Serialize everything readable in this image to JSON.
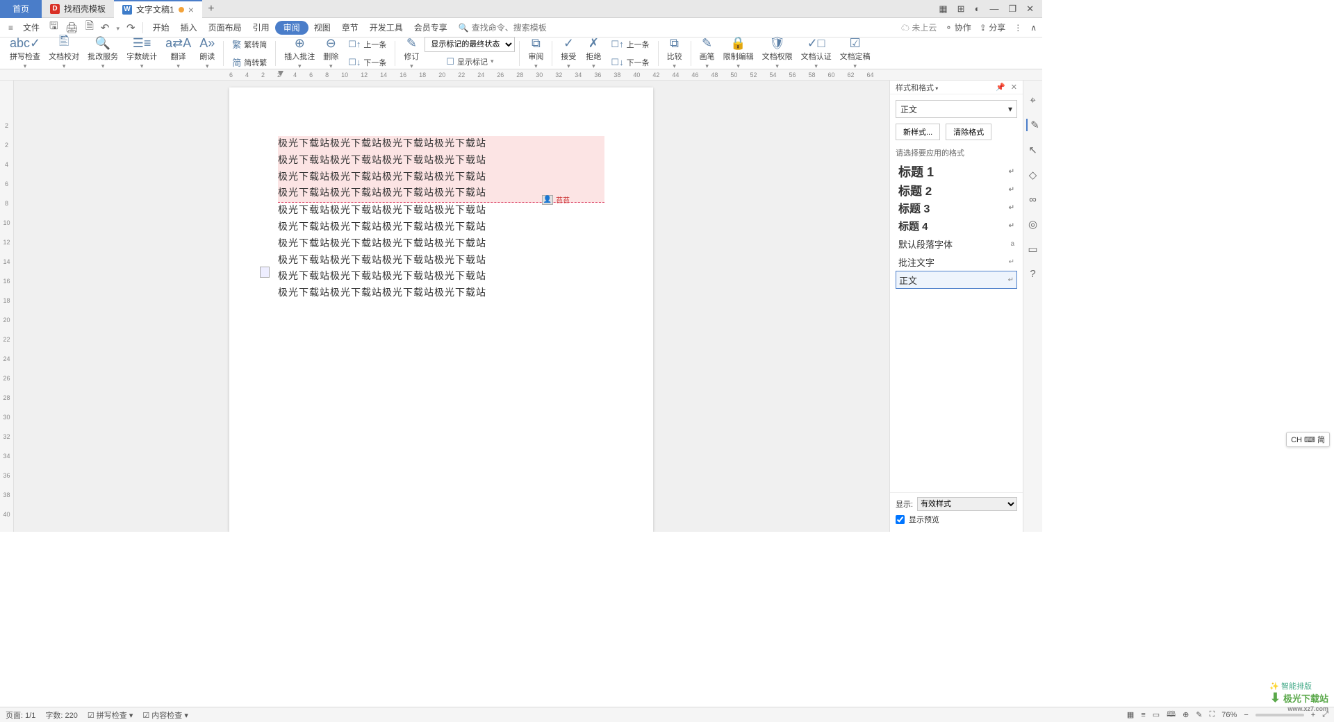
{
  "tabs": {
    "home": "首页",
    "template": "找稻壳模板",
    "doc": "文字文稿1"
  },
  "window_controls": {
    "grid": "▦",
    "apps": "⊞",
    "avatar": "◐",
    "min": "—",
    "max": "❐",
    "close": "✕"
  },
  "menubar": {
    "file": "文件",
    "items": [
      "开始",
      "插入",
      "页面布局",
      "引用",
      "审阅",
      "视图",
      "章节",
      "开发工具",
      "会员专享"
    ],
    "active": 4,
    "search_placeholder": "查找命令、搜索模板",
    "right": {
      "cloud": "未上云",
      "collab": "协作",
      "share": "分享"
    }
  },
  "ribbon": {
    "g1": [
      {
        "icon": "abc✓",
        "lbl": "拼写检查"
      },
      {
        "icon": "🖺",
        "lbl": "文档校对"
      },
      {
        "icon": "🔍",
        "lbl": "批改服务"
      },
      {
        "icon": "☰≡",
        "lbl": "字数统计"
      },
      {
        "icon": "a⇄A",
        "lbl": "翻译"
      },
      {
        "icon": "A»",
        "lbl": "朗读"
      }
    ],
    "g2a": {
      "icon": "繁",
      "lbl": "繁转简"
    },
    "g2b": {
      "icon": "简",
      "lbl": "简转繁"
    },
    "g3": [
      {
        "icon": "⊕",
        "lbl": "插入批注"
      },
      {
        "icon": "⊖",
        "lbl": "删除"
      }
    ],
    "g3b": [
      {
        "icon": "☐↑",
        "lbl": "上一条"
      },
      {
        "icon": "☐↓",
        "lbl": "下一条"
      }
    ],
    "g4": {
      "icon": "✎",
      "lbl": "修订"
    },
    "select": "显示标记的最终状态",
    "show_mark": {
      "icon": "☐",
      "lbl": "显示标记"
    },
    "g5": {
      "icon": "⧉",
      "lbl": "审阅"
    },
    "g6a": {
      "icon": "✓",
      "lbl": "接受"
    },
    "g6b": {
      "icon": "✗",
      "lbl": "拒绝"
    },
    "g6c": [
      {
        "icon": "☐↑",
        "lbl": "上一条"
      },
      {
        "icon": "☐↓",
        "lbl": "下一条"
      }
    ],
    "g7": {
      "icon": "⧉",
      "lbl": "比较"
    },
    "g8": [
      {
        "icon": "✎",
        "lbl": "画笔"
      },
      {
        "icon": "🔒",
        "lbl": "限制编辑"
      },
      {
        "icon": "🛡",
        "lbl": "文档权限"
      },
      {
        "icon": "✓□",
        "lbl": "文档认证"
      },
      {
        "icon": "☑",
        "lbl": "文档定稿"
      }
    ]
  },
  "ruler": [
    "6",
    "4",
    "2",
    "2",
    "4",
    "6",
    "8",
    "10",
    "12",
    "14",
    "16",
    "18",
    "20",
    "22",
    "24",
    "26",
    "28",
    "30",
    "32",
    "34",
    "36",
    "38",
    "40",
    "42",
    "44",
    "46",
    "48",
    "50",
    "52",
    "54",
    "56",
    "58",
    "60",
    "62",
    "64"
  ],
  "ruler_v": [
    "2",
    "2",
    "4",
    "6",
    "8",
    "10",
    "12",
    "14",
    "16",
    "18",
    "20",
    "22",
    "24",
    "26",
    "28",
    "30",
    "32",
    "34",
    "36",
    "38",
    "40"
  ],
  "doc_line": "极光下载站极光下载站极光下载站极光下载站",
  "doc_highlight_count": 4,
  "doc_normal_count": 6,
  "panel": {
    "title": "样式和格式",
    "current": "正文",
    "btn_new": "新样式...",
    "btn_clear": "清除格式",
    "hint": "请选择要应用的格式",
    "styles": [
      {
        "name": "标题 1",
        "cls": "h1"
      },
      {
        "name": "标题 2",
        "cls": "h2"
      },
      {
        "name": "标题 3",
        "cls": "h3"
      },
      {
        "name": "标题 4",
        "cls": "h4"
      },
      {
        "name": "默认段落字体",
        "cls": "def",
        "mark": "a"
      },
      {
        "name": "批注文字",
        "cls": "cm"
      },
      {
        "name": "正文",
        "cls": "body sel"
      }
    ],
    "show_label": "显示:",
    "show_value": "有效样式",
    "preview": "显示预览",
    "smart": "智能排版"
  },
  "status": {
    "page": "页面: 1/1",
    "words": "字数: 220",
    "spell": "拼写检查",
    "content": "内容检查",
    "zoom": "76%"
  },
  "ime": "CH ⌨ 简",
  "watermark": {
    "main": "极光下载站",
    "sub": "www.xz7.com"
  }
}
